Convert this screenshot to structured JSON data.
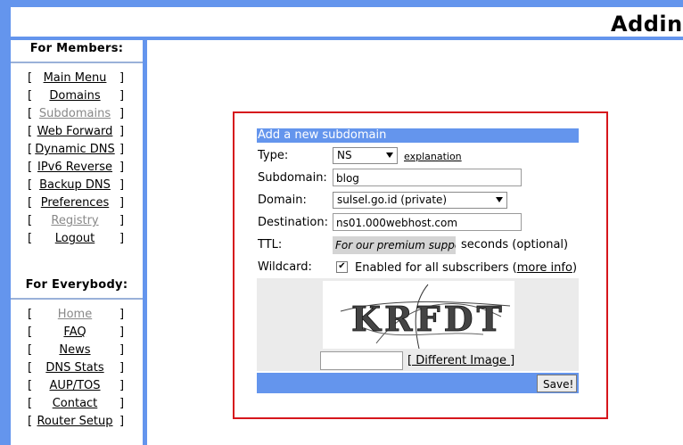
{
  "header": {
    "title": "Adding"
  },
  "sidebar": {
    "members_heading": "For Members:",
    "members_items": [
      {
        "label": "Main Menu",
        "active": true
      },
      {
        "label": "Domains",
        "active": true
      },
      {
        "label": "Subdomains",
        "active": false
      },
      {
        "label": "Web Forward",
        "active": true
      },
      {
        "label": "Dynamic DNS",
        "active": true
      },
      {
        "label": "IPv6 Reverse",
        "active": true
      },
      {
        "label": "Backup DNS",
        "active": true
      },
      {
        "label": "Preferences",
        "active": true
      },
      {
        "label": "Registry",
        "active": false
      },
      {
        "label": "Logout",
        "active": true
      }
    ],
    "everybody_heading": "For Everybody:",
    "everybody_items": [
      {
        "label": "Home",
        "active": false
      },
      {
        "label": "FAQ",
        "active": true
      },
      {
        "label": "News",
        "active": true
      },
      {
        "label": "DNS Stats",
        "active": true
      },
      {
        "label": "AUP/TOS",
        "active": true
      },
      {
        "label": "Contact",
        "active": true
      },
      {
        "label": "Router Setup",
        "active": true
      }
    ],
    "bracket_left": "[",
    "bracket_right": "]"
  },
  "form": {
    "heading": "Add a new subdomain",
    "type_label": "Type:",
    "type_value": "NS",
    "explanation_link": "explanation",
    "subdomain_label": "Subdomain:",
    "subdomain_value": "blog",
    "domain_label": "Domain:",
    "domain_value": "sulsel.go.id (private)",
    "destination_label": "Destination:",
    "destination_value": "ns01.000webhost.com",
    "ttl_label": "TTL:",
    "ttl_value": "For our premium suppo",
    "ttl_suffix": "seconds (optional)",
    "wildcard_label": "Wildcard:",
    "wildcard_checked": true,
    "wildcard_text": "Enabled for all subscribers",
    "more_info_link": "more info",
    "captcha_text": "KRFDT",
    "different_image_link": "[ Different Image ]",
    "save_label": "Save!"
  },
  "colors": {
    "accent": "#6495ed",
    "highlight_border": "#d6161c",
    "panel": "#ebebeb"
  }
}
